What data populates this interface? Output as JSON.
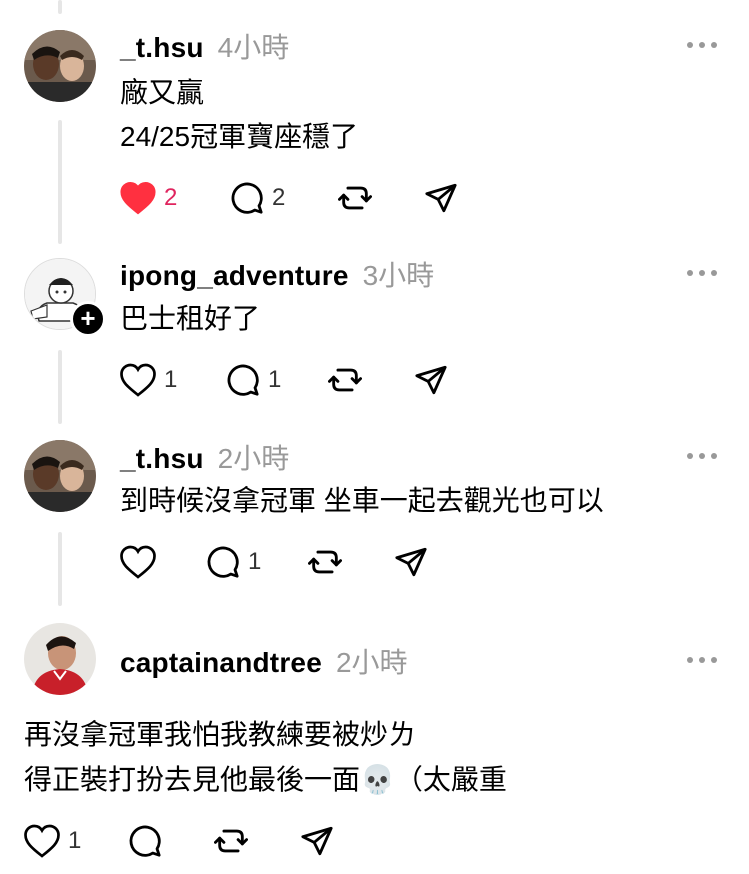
{
  "posts": [
    {
      "username": "_t.hsu",
      "time": "4小時",
      "lines": [
        "廠又贏",
        "24/25冠軍寶座穩了"
      ],
      "likes": "2",
      "comments": "2",
      "liked": true
    },
    {
      "username": "ipong_adventure",
      "time": "3小時",
      "lines": [
        "巴士租好了"
      ],
      "likes": "1",
      "comments": "1",
      "follow_badge": "+"
    },
    {
      "username": "_t.hsu",
      "time": "2小時",
      "lines": [
        "到時候沒拿冠軍 坐車一起去觀光也可以"
      ],
      "comments": "1"
    },
    {
      "username": "captainandtree",
      "time": "2小時",
      "lines": [
        "再沒拿冠軍我怕我教練要被炒ㄌ",
        "得正裝打扮去見他最後一面💀（太嚴重"
      ],
      "likes": "1"
    }
  ],
  "colors": {
    "like_active": "#ff3040",
    "muted": "#999999",
    "thread_line": "#e6e6e6"
  },
  "icons": [
    "heart-icon",
    "comment-icon",
    "repost-icon",
    "share-icon",
    "more-icon",
    "plus-icon"
  ]
}
